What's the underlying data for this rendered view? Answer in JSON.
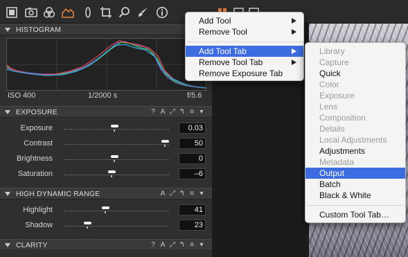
{
  "toolbar": {
    "icons": [
      "library-icon",
      "camera-icon",
      "color-icon",
      "exposure-tab-icon",
      "lens-icon",
      "crop-icon",
      "magnifier-icon",
      "brush-icon",
      "info-icon",
      "grid-icon",
      "window-icon",
      "window-icon"
    ]
  },
  "histogram": {
    "title": "HISTOGRAM",
    "iso": "ISO 400",
    "shutter": "1/2000 s",
    "aperture": "f/5.6"
  },
  "exposure": {
    "title": "EXPOSURE",
    "controls": [
      "?",
      "A",
      "⤢",
      "↰",
      "≡",
      "▾"
    ],
    "rows": [
      {
        "label": "Exposure",
        "value": "0.03",
        "position": 0.5
      },
      {
        "label": "Contrast",
        "value": "50",
        "position": 1.0
      },
      {
        "label": "Brightness",
        "value": "0",
        "position": 0.5
      },
      {
        "label": "Saturation",
        "value": "–6",
        "position": 0.47
      }
    ]
  },
  "hdr": {
    "title": "HIGH DYNAMIC RANGE",
    "controls": [
      "A",
      "⤢",
      "↰",
      "≡",
      "▾"
    ],
    "rows": [
      {
        "label": "Highlight",
        "value": "41",
        "position": 0.41
      },
      {
        "label": "Shadow",
        "value": "23",
        "position": 0.23
      }
    ]
  },
  "clarity": {
    "title": "CLARITY",
    "controls": [
      "?",
      "A",
      "⤢",
      "↰",
      "≡",
      "▾"
    ]
  },
  "context_menu": {
    "items": [
      {
        "label": "Add Tool",
        "submenu": true
      },
      {
        "label": "Remove Tool",
        "submenu": true
      },
      {
        "label": "Add Tool Tab",
        "submenu": true,
        "selected": true
      },
      {
        "label": "Remove Tool Tab",
        "submenu": true
      },
      {
        "label": "Remove Exposure Tab",
        "submenu": false
      }
    ]
  },
  "submenu": {
    "items": [
      {
        "label": "Library",
        "enabled": false
      },
      {
        "label": "Capture",
        "enabled": false
      },
      {
        "label": "Quick",
        "enabled": true
      },
      {
        "label": "Color",
        "enabled": false
      },
      {
        "label": "Exposure",
        "enabled": false
      },
      {
        "label": "Lens",
        "enabled": false
      },
      {
        "label": "Composition",
        "enabled": false
      },
      {
        "label": "Details",
        "enabled": false
      },
      {
        "label": "Local Adjustments",
        "enabled": false
      },
      {
        "label": "Adjustments",
        "enabled": true
      },
      {
        "label": "Metadata",
        "enabled": false
      },
      {
        "label": "Output",
        "enabled": true,
        "selected": true
      },
      {
        "label": "Batch",
        "enabled": true
      },
      {
        "label": "Black & White",
        "enabled": true
      }
    ],
    "footer": "Custom Tool Tab…"
  },
  "colors": {
    "selection": "#3d6be0",
    "active_tab": "#e8823a"
  }
}
